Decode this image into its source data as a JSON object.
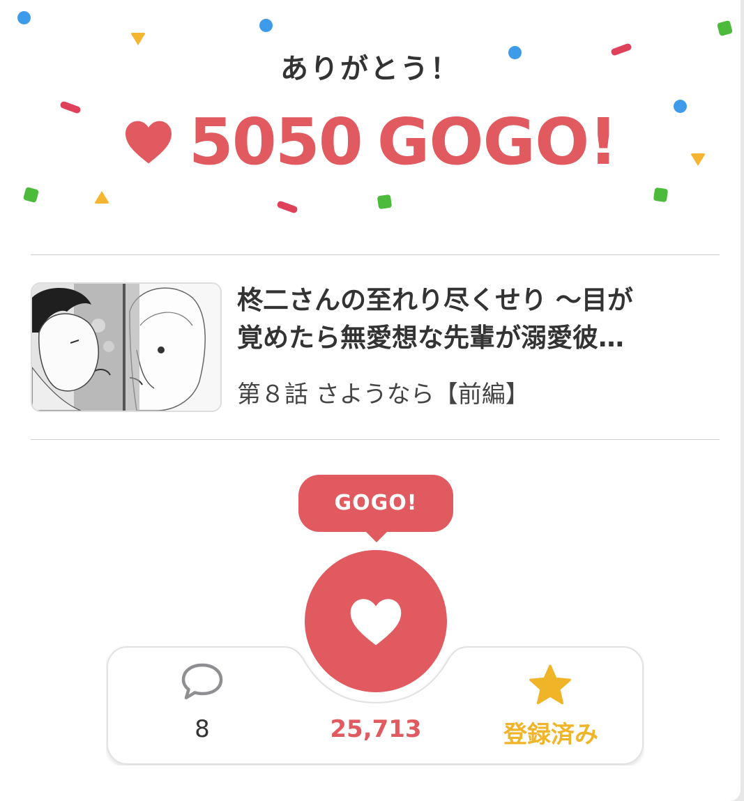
{
  "header": {
    "thanks": "ありがとう！",
    "gogo_count": "5050",
    "gogo_label": "GOGO!"
  },
  "episode_card": {
    "title_line1": "柊二さんの至れり尽くせり 〜目が",
    "title_line2": "覚めたら無愛想な先輩が溺愛彼…",
    "episode_label": "第８話 さようなら【前編】"
  },
  "gogo_button": {
    "bubble_label": "GOGO!",
    "icon": "heart-icon"
  },
  "stats": {
    "comments_count": "8",
    "gogo_total": "25,713",
    "favorite_label": "登録済み"
  },
  "colors": {
    "accent": "#e05a60",
    "favorite": "#f0b429",
    "confetti_blue": "#3d9be9",
    "confetti_green": "#4cbb3c",
    "confetti_yellow": "#f5b531",
    "confetti_pink": "#e0415a"
  }
}
